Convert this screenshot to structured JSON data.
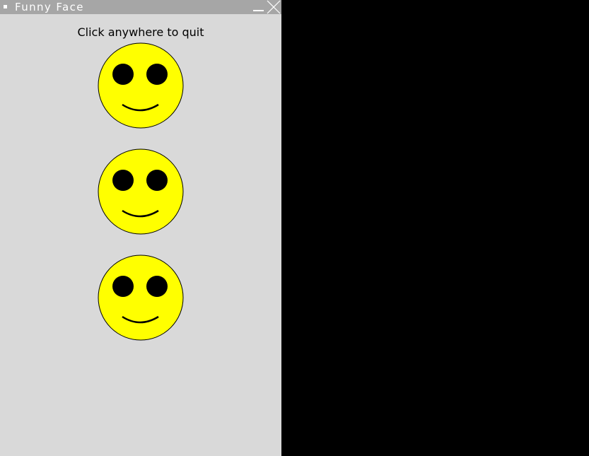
{
  "window": {
    "title": "Funny Face",
    "background_color": "#d9d9d9",
    "titlebar_color": "#a6a6a6"
  },
  "canvas": {
    "instruction": "Click anywhere to quit"
  },
  "faces": [
    {
      "name": "smiley-face-1",
      "face_color": "#ffff00",
      "eye_color": "#000000"
    },
    {
      "name": "smiley-face-2",
      "face_color": "#ffff00",
      "eye_color": "#000000"
    },
    {
      "name": "smiley-face-3",
      "face_color": "#ffff00",
      "eye_color": "#000000"
    }
  ],
  "icons": {
    "menu": "window-menu-icon",
    "minimize": "minimize-icon",
    "close": "close-icon"
  }
}
